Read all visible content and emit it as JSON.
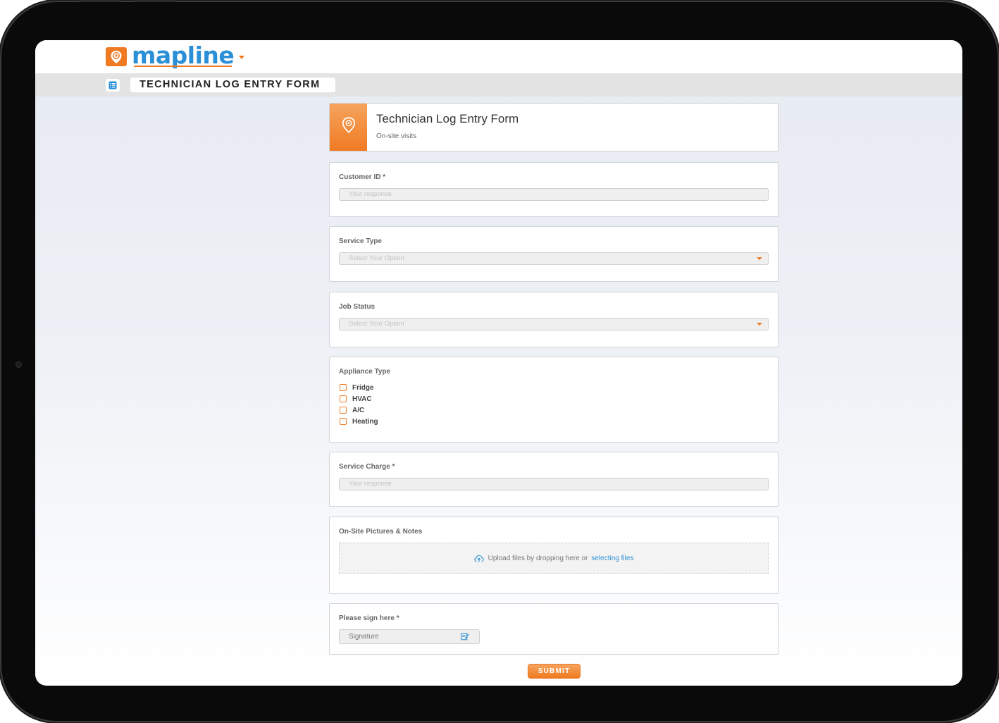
{
  "app": {
    "logo_text": "mapline",
    "page_title": "TECHNICIAN LOG ENTRY FORM"
  },
  "form": {
    "title": "Technician Log Entry Form",
    "subtitle": "On-site visits",
    "customer_id": {
      "label": "Customer ID *",
      "placeholder": "Your response"
    },
    "service_type": {
      "label": "Service Type",
      "placeholder": "Select Your Option"
    },
    "job_status": {
      "label": "Job Status",
      "placeholder": "Select Your Option"
    },
    "appliance_type": {
      "label": "Appliance Type",
      "options": [
        "Fridge",
        "HVAC",
        "A/C",
        "Heating"
      ]
    },
    "service_charge": {
      "label": "Service Charge *",
      "placeholder": "Your response"
    },
    "pictures": {
      "label": "On-Site Pictures & Notes",
      "upload_text": "Upload files by dropping here or",
      "upload_link": "selecting files"
    },
    "signature": {
      "label": "Please sign here *",
      "placeholder": "Signature"
    },
    "submit_label": "SUBMIT"
  },
  "icons": {
    "logo": "map-pin-icon",
    "page": "list-icon",
    "upload": "cloud-upload-icon",
    "signature": "edit-icon"
  },
  "colors": {
    "accent": "#f07a22",
    "brand_blue": "#2a8fd6"
  }
}
